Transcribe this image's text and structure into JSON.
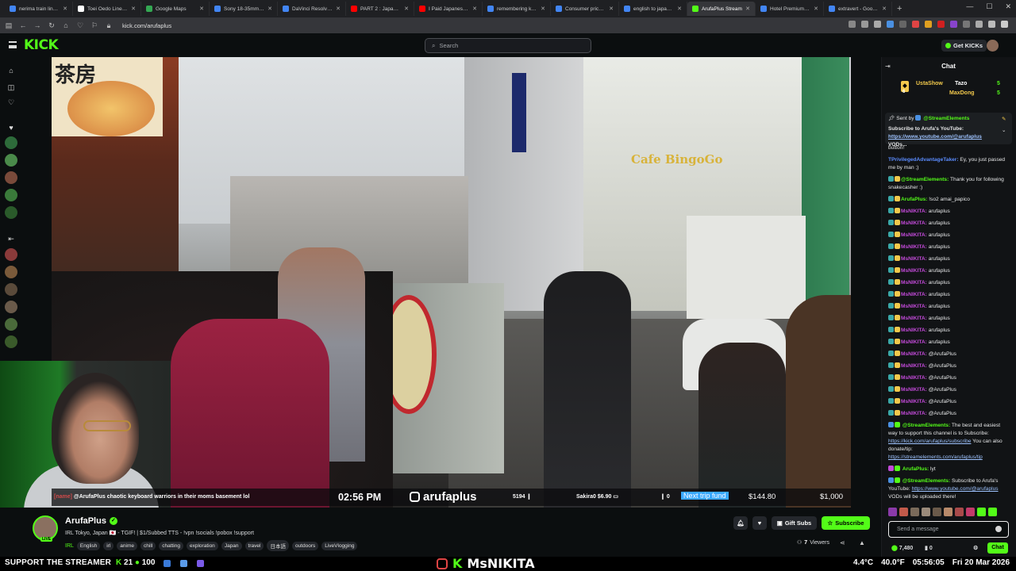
{
  "browser": {
    "tabs": [
      {
        "title": "nerima train line map",
        "color": "#4285f4"
      },
      {
        "title": "Toei Ōedo Line - Wiki",
        "color": "#ffffff"
      },
      {
        "title": "Google Maps",
        "color": "#34a853"
      },
      {
        "title": "Sony 18-35mm GM Le",
        "color": "#4285f4"
      },
      {
        "title": "DaVinci Resolve — M",
        "color": "#4285f4"
      },
      {
        "title": "PART 2 : Japan is curr",
        "color": "#ff0000"
      },
      {
        "title": "I Paid Japanese Peopl",
        "color": "#ff0000"
      },
      {
        "title": "remembering kanji -",
        "color": "#4285f4"
      },
      {
        "title": "Consumer price inflati",
        "color": "#4285f4"
      },
      {
        "title": "english to japanese -",
        "color": "#4285f4"
      },
      {
        "title": "ArufaPlus Stream",
        "color": "#53fc18",
        "active": true
      },
      {
        "title": "Hotel Premium Green",
        "color": "#4285f4"
      },
      {
        "title": "extravert - Google Se",
        "color": "#4285f4"
      }
    ],
    "url": "kick.com/arufaplus"
  },
  "header": {
    "logo": "KICK",
    "search_placeholder": "Search",
    "get_kicks": "Get KICKs"
  },
  "stream_overlay": {
    "chat_user": "[name]",
    "chat_text": "@ArufaPlus chaotic keyboard warriors in their moms basement lol",
    "time": "02:56 PM",
    "handle": "arufaplus",
    "stat1": "5194",
    "stat2": "Sakira0 $6.90",
    "stat3": "0",
    "trip_label": "Next trip fund",
    "trip_current": "$144.80",
    "trip_goal": "$1,000"
  },
  "video_scene": {
    "shop_sign": "茶房",
    "cafe_sign": "Cafe BingoGo"
  },
  "channel": {
    "name": "ArufaPlus",
    "live_badge": "LIVE",
    "title": "IRL Tokyo, Japan 🇯🇵 - TGIF! | $1/Subbed TTS - !vpn !socials !pobox !support",
    "category": "IRL",
    "tags": [
      "English",
      "irl",
      "anime",
      "chill",
      "chatting",
      "exploration",
      "Japan",
      "travel",
      "日本語",
      "outdoors",
      "LiveVlogging"
    ],
    "gift_subs": "Gift Subs",
    "subscribe": "Subscribe",
    "viewers_count": "7",
    "viewers_label": "Viewers"
  },
  "chat": {
    "title": "Chat",
    "leaderboard": [
      {
        "name": "UstaShow",
        "count": "6",
        "color": "#f2c94c"
      },
      {
        "name": "Tazo",
        "count": "5",
        "color": "#ffffff"
      },
      {
        "name": "MaxDong",
        "count": "5",
        "color": "#f2c94c"
      }
    ],
    "pinned": {
      "sent_by": "Sent by",
      "user": "@StreamElements",
      "text": "Subscribe to Arufa's YouTube:",
      "link": "https://www.youtube.com/@arufaplus",
      "tail": "VODs..."
    },
    "messages": [
      {
        "user": "",
        "text": "button!",
        "color": "#e6e7e8"
      },
      {
        "user": "TPrivilegedAdvantageTaker:",
        "text": "Ey, you just passed me by man ;)",
        "color": "#5b8cff"
      },
      {
        "user": "@StreamElements:",
        "text": "Thank you for following snakecasher :)",
        "color": "#53fc18"
      },
      {
        "user": "ArufaPlus:",
        "text": "!so2 amai_papico",
        "color": "#53fc18"
      },
      {
        "user": "MsNIKITA:",
        "text": "arufaplus",
        "color": "#c24ad8"
      },
      {
        "user": "MsNIKITA:",
        "text": "arufaplus",
        "color": "#c24ad8"
      },
      {
        "user": "MsNIKITA:",
        "text": "arufaplus",
        "color": "#c24ad8"
      },
      {
        "user": "MsNIKITA:",
        "text": "arufaplus",
        "color": "#c24ad8"
      },
      {
        "user": "MsNIKITA:",
        "text": "arufaplus",
        "color": "#c24ad8"
      },
      {
        "user": "MsNIKITA:",
        "text": "arufaplus",
        "color": "#c24ad8"
      },
      {
        "user": "MsNIKITA:",
        "text": "arufaplus",
        "color": "#c24ad8"
      },
      {
        "user": "MsNIKITA:",
        "text": "arufaplus",
        "color": "#c24ad8"
      },
      {
        "user": "MsNIKITA:",
        "text": "arufaplus",
        "color": "#c24ad8"
      },
      {
        "user": "MsNIKITA:",
        "text": "arufaplus",
        "color": "#c24ad8"
      },
      {
        "user": "MsNIKITA:",
        "text": "arufaplus",
        "color": "#c24ad8"
      },
      {
        "user": "MsNIKITA:",
        "text": "arufaplus",
        "color": "#c24ad8"
      },
      {
        "user": "MsNIKITA:",
        "text": "@ArufaPlus",
        "color": "#c24ad8"
      },
      {
        "user": "MsNIKITA:",
        "text": "@ArufaPlus",
        "color": "#c24ad8"
      },
      {
        "user": "MsNIKITA:",
        "text": "@ArufaPlus",
        "color": "#c24ad8"
      },
      {
        "user": "MsNIKITA:",
        "text": "@ArufaPlus",
        "color": "#c24ad8"
      },
      {
        "user": "MsNIKITA:",
        "text": "@ArufaPlus",
        "color": "#c24ad8"
      },
      {
        "user": "MsNIKITA:",
        "text": "@ArufaPlus",
        "color": "#c24ad8"
      }
    ],
    "se_msg1": {
      "user": "@StreamElements:",
      "text": "The best and easiest way to support this channel is to Subscribe:",
      "link1": "https://kick.com/arufaplus/subscribe",
      "mid": "You can also donate/tip:",
      "link2": "https://streamelements.com/arufaplus/tip"
    },
    "arufa_msg": {
      "user": "ArufaPlus:",
      "text": "lyt"
    },
    "se_msg2": {
      "user": "@StreamElements:",
      "text": "Subscribe to Arufa's YouTube:",
      "link": "https://www.youtube.com/@arufaplus",
      "tail": "VODs will be uploaded there!"
    },
    "input_placeholder": "Send a message",
    "kicks_balance": "7,480",
    "points": "0",
    "chat_button": "Chat"
  },
  "taskbar": {
    "left_text": "SUPPORT THE STREAMER",
    "count1": "21",
    "count2": "100",
    "center_k": "K",
    "center_name": "MsNIKITA",
    "temp": "4.4°C",
    "temp2": "40.0°F",
    "clock": "05:56:05",
    "date": "Fri 20 Mar 2026"
  }
}
